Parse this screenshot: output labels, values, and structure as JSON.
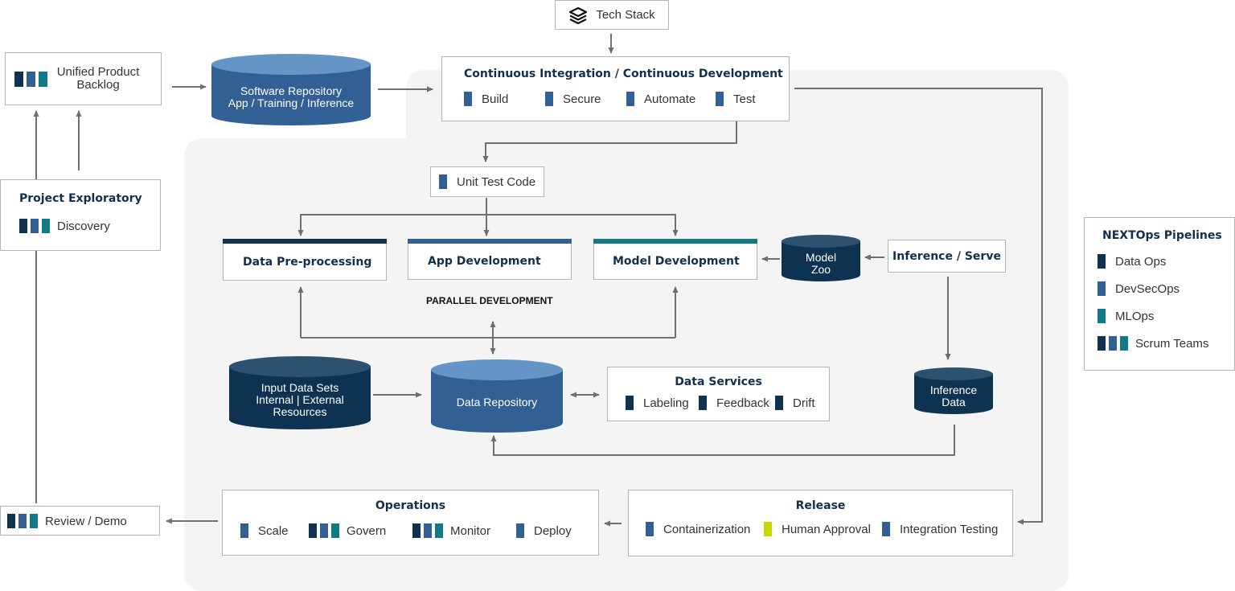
{
  "colors": {
    "data_ops": "#0e3352",
    "devsecops": "#336094",
    "mlops": "#117a87",
    "human_approval": "#c9d600",
    "panel_bg": "#f4f4f4",
    "line": "#707070"
  },
  "tech_stack": {
    "label": "Tech Stack",
    "icon": "layers-icon"
  },
  "backlog": {
    "line1": "Unified Product",
    "line2": "Backlog"
  },
  "software_repo": {
    "line1": "Software Repository",
    "line2": "App / Training / Inference"
  },
  "cicd": {
    "title": "Continuous Integration / Continuous Development",
    "items": [
      "Build",
      "Secure",
      "Automate",
      "Test"
    ]
  },
  "unit_test": {
    "label": "Unit Test Code"
  },
  "project_exploratory": {
    "title": "Project Exploratory",
    "item": "Discovery"
  },
  "dev": {
    "data_preprocessing": "Data Pre-processing",
    "app_development": "App Development",
    "model_development": "Model Development",
    "parallel_label": "PARALLEL DEVELOPMENT"
  },
  "model_zoo": {
    "line1": "Model",
    "line2": "Zoo"
  },
  "inference_serve": {
    "label": "Inference / Serve"
  },
  "inference_data": {
    "line1": "Inference",
    "line2": "Data"
  },
  "input_data": {
    "line1": "Input Data Sets",
    "line2": "Internal | External",
    "line3": "Resources"
  },
  "data_repo": {
    "label": "Data Repository"
  },
  "data_services": {
    "title": "Data Services",
    "items": [
      "Labeling",
      "Feedback",
      "Drift"
    ]
  },
  "legend": {
    "title": "NEXTOps Pipelines",
    "items": [
      "Data Ops",
      "DevSecOps",
      "MLOps",
      "Scrum Teams"
    ]
  },
  "review": {
    "label": "Review / Demo"
  },
  "operations": {
    "title": "Operations",
    "items": [
      "Scale",
      "Govern",
      "Monitor",
      "Deploy"
    ]
  },
  "release": {
    "title": "Release",
    "items": [
      "Containerization",
      "Human Approval",
      "Integration Testing"
    ]
  }
}
